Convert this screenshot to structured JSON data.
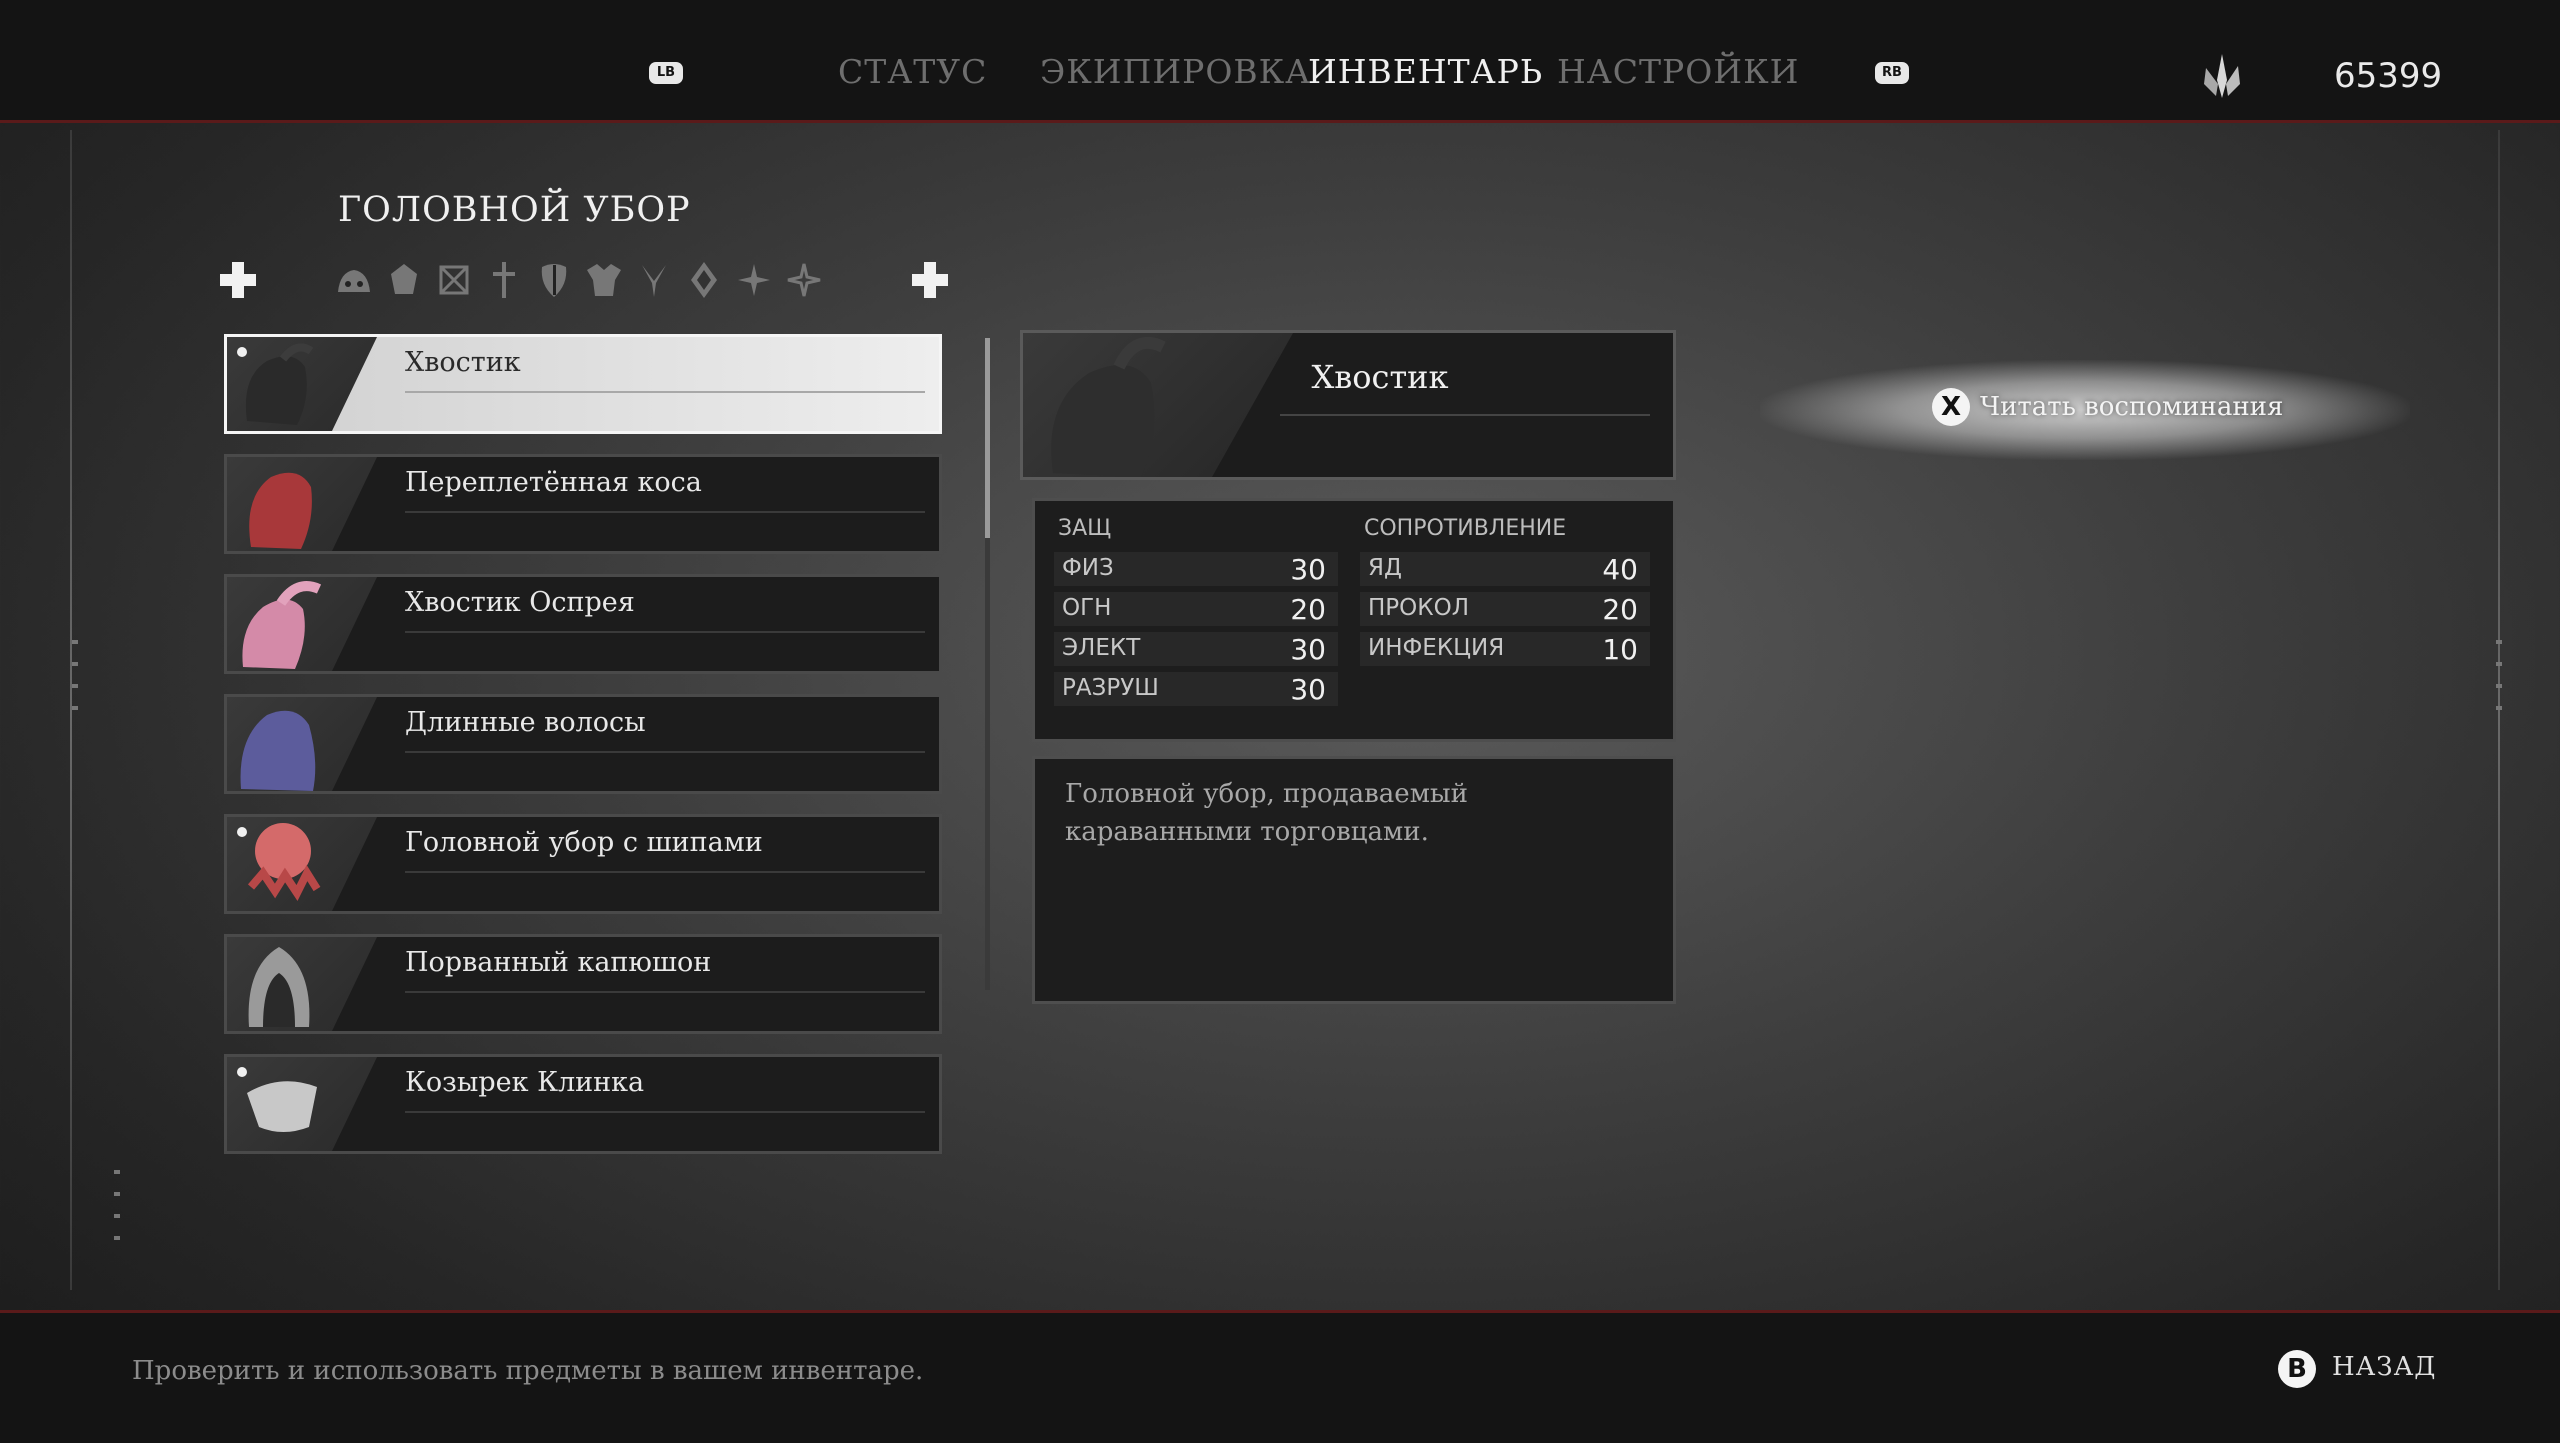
{
  "top_nav": {
    "left_bumper": "LB",
    "right_bumper": "RB",
    "tabs": [
      {
        "label": "СТАТУС",
        "active": false
      },
      {
        "label": "ЭКИПИРОВКА",
        "active": false
      },
      {
        "label": "ИНВЕНТАРЬ",
        "active": true
      },
      {
        "label": "НАСТРОЙКИ",
        "active": false
      }
    ],
    "currency_icon": "haze-crystal-icon",
    "currency_amount": "65399"
  },
  "inventory": {
    "category_title": "ГОЛОВНОЙ УБОР",
    "filter_icons": [
      "skull-helm-icon",
      "gem-icon",
      "crossed-box-icon",
      "sword-icon",
      "mask-icon",
      "armor-icon",
      "claw-icon",
      "diamond-icon",
      "star-icon",
      "sparkle-icon"
    ],
    "items": [
      {
        "name": "Хвостик",
        "icon": "ponytail-gray-icon",
        "color": "#4a4a4a",
        "new": true,
        "selected": true
      },
      {
        "name": "Переплетённая коса",
        "icon": "braid-red-icon",
        "color": "#a8383a",
        "new": false,
        "selected": false
      },
      {
        "name": "Хвостик Оспрея",
        "icon": "ponytail-pink-icon",
        "color": "#d48aa8",
        "new": false,
        "selected": false
      },
      {
        "name": "Длинные волосы",
        "icon": "long-hair-blue-icon",
        "color": "#5c5c9c",
        "new": false,
        "selected": false
      },
      {
        "name": "Головной убор с шипами",
        "icon": "spiked-head-icon",
        "color": "#d46a6a",
        "new": true,
        "selected": false
      },
      {
        "name": "Порванный капюшон",
        "icon": "torn-hood-icon",
        "color": "#9a9a9a",
        "new": false,
        "selected": false
      },
      {
        "name": "Козырек Клинка",
        "icon": "visor-icon",
        "color": "#c8c8c8",
        "new": true,
        "selected": false
      }
    ]
  },
  "detail": {
    "name": "Хвостик",
    "defense_header": "ЗАЩ",
    "resistance_header": "СОПРОТИВЛЕНИЕ",
    "defense": [
      {
        "label": "ФИЗ",
        "value": "30"
      },
      {
        "label": "ОГН",
        "value": "20"
      },
      {
        "label": "ЭЛЕКТ",
        "value": "30"
      },
      {
        "label": "РАЗРУШ",
        "value": "30"
      }
    ],
    "resistance": [
      {
        "label": "ЯД",
        "value": "40"
      },
      {
        "label": "ПРОКОЛ",
        "value": "20"
      },
      {
        "label": "ИНФЕКЦИЯ",
        "value": "10"
      }
    ],
    "description": "Головной убор, продаваемый караванными торговцами."
  },
  "action": {
    "button": "X",
    "label": "Читать воспоминания"
  },
  "footer": {
    "hint": "Проверить и использовать предметы в вашем инвентаре.",
    "back_button": "B",
    "back_label": "НАЗАД"
  }
}
